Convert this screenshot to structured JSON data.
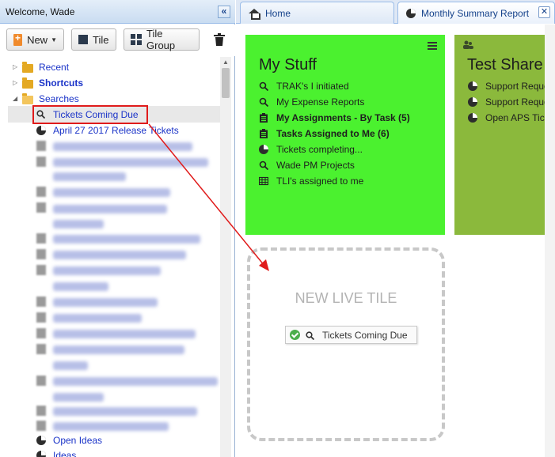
{
  "left_panel": {
    "title": "Welcome, Wade",
    "collapse_glyph": "«",
    "toolbar": {
      "new_label": "New",
      "tile_label": "Tile",
      "tile_group_label": "Tile Group"
    },
    "tree": {
      "recent": "Recent",
      "shortcuts": "Shortcuts",
      "searches": "Searches",
      "selected_item": "Tickets Coming Due",
      "release_item": "April 27 2017 Release Tickets",
      "open_ideas": "Open Ideas",
      "ideas": "Ideas"
    }
  },
  "tabs": {
    "home": "Home",
    "monthly": "Monthly Summary Report",
    "close_glyph": "✕"
  },
  "tiles": {
    "my_stuff": {
      "title": "My Stuff",
      "items": [
        {
          "label": "TRAK's I initiated",
          "icon": "search-icon",
          "bold": false
        },
        {
          "label": "My Expense Reports",
          "icon": "search-icon",
          "bold": false
        },
        {
          "label": "My Assignments - By Task (5)",
          "icon": "clipboard-icon",
          "bold": true
        },
        {
          "label": "Tasks Assigned to Me (6)",
          "icon": "clipboard-icon",
          "bold": true
        },
        {
          "label": "Tickets completing...",
          "icon": "pie-chart-icon",
          "bold": false
        },
        {
          "label": "Wade PM Projects",
          "icon": "search-icon",
          "bold": false
        },
        {
          "label": "TLI's assigned to me",
          "icon": "table-icon",
          "bold": false
        }
      ],
      "color": "#4bf12f"
    },
    "test_share": {
      "title": "Test Share",
      "items": [
        {
          "label": "Support Reques",
          "icon": "pie-chart-icon"
        },
        {
          "label": "Support Reques",
          "icon": "pie-chart-icon"
        },
        {
          "label": "Open APS Ticke",
          "icon": "pie-chart-icon"
        }
      ],
      "color": "#8bb93c"
    },
    "new_live_tile": {
      "label": "NEW LIVE TILE",
      "drag_chip_label": "Tickets Coming Due"
    }
  }
}
